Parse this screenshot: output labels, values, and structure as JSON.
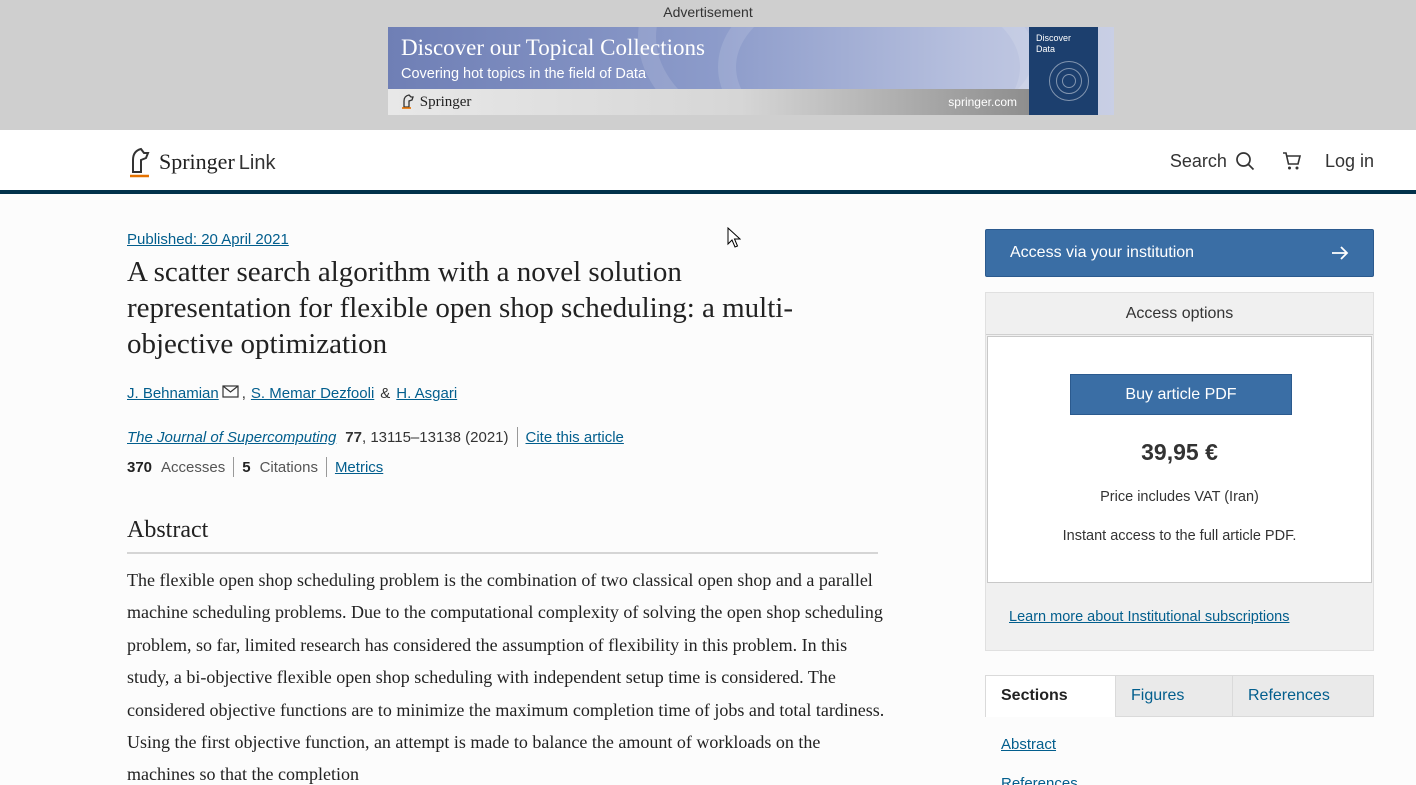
{
  "ad": {
    "label": "Advertisement",
    "title": "Discover our Topical Collections",
    "subtitle": "Covering hot topics in the field of Data",
    "brand": "Springer",
    "url": "springer.com",
    "cover_title": "Discover Data"
  },
  "header": {
    "logo_main": "Springer",
    "logo_sub": "Link",
    "search_label": "Search",
    "login_label": "Log in"
  },
  "article": {
    "published": "Published: 20 April 2021",
    "title": "A scatter search algorithm with a novel solution representation for flexible open shop scheduling: a multi-objective optimization",
    "authors": [
      "J. Behnamian",
      "S. Memar Dezfooli",
      "H. Asgari"
    ],
    "author_sep_1": ",",
    "author_sep_2": "&",
    "journal": "The Journal of Supercomputing",
    "volume": "77",
    "pages_year": ", 13115–13138 (2021)",
    "cite_label": "Cite this article",
    "accesses_count": "370",
    "accesses_label": "Accesses",
    "citations_count": "5",
    "citations_label": "Citations",
    "metrics_label": "Metrics",
    "abstract_heading": "Abstract",
    "abstract_text": "The flexible open shop scheduling problem is the combination of two classical open shop and a parallel machine scheduling problems. Due to the computational complexity of solving the open shop scheduling problem, so far, limited research has considered the assumption of flexibility in this problem. In this study, a bi-objective flexible open shop scheduling with independent setup time is considered. The considered objective functions are to minimize the maximum completion time of jobs and total tardiness. Using the first objective function, an attempt is made to balance the amount of workloads on the machines so that the completion"
  },
  "sidebar": {
    "institution_button": "Access via your institution",
    "access_options": "Access options",
    "buy_button": "Buy article PDF",
    "price": "39,95 €",
    "vat_note": "Price includes VAT (Iran)",
    "instant_note": "Instant access to the full article PDF.",
    "learn_more": "Learn more about Institutional subscriptions",
    "tabs": [
      "Sections",
      "Figures",
      "References"
    ],
    "section_links": [
      "Abstract",
      "References"
    ]
  },
  "colors": {
    "link": "#025e8d",
    "button": "#3a6ea5",
    "header_rule": "#01324b"
  }
}
